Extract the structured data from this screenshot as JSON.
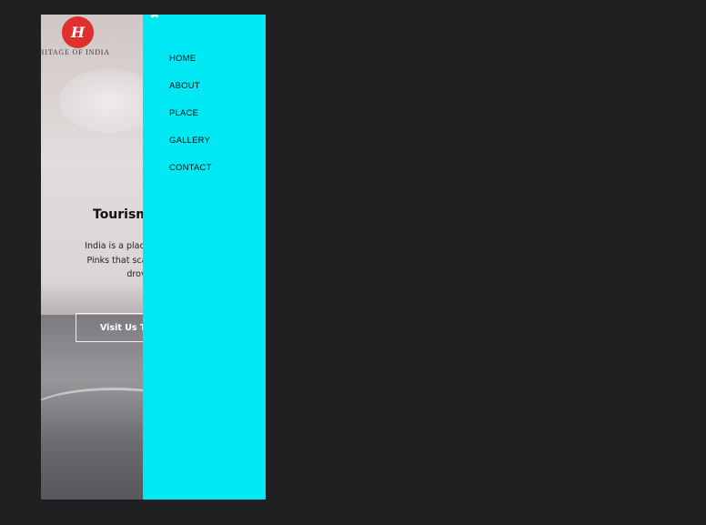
{
  "brand": {
    "logo_letter": "H",
    "name": "HERITAGE OF INDIA",
    "logo_color": "#e0302e"
  },
  "hero": {
    "title": "Tourism",
    "text_lines": [
      "India is a place where",
      "Pinks that scald your",
      "drov"
    ],
    "cta_label": "Visit Us To"
  },
  "drawer": {
    "background": "#00e8f3",
    "close_icon": "close-icon",
    "menu": [
      {
        "label": "HOME"
      },
      {
        "label": "ABOUT"
      },
      {
        "label": "PLACE"
      },
      {
        "label": "GALLERY"
      },
      {
        "label": "CONTACT"
      }
    ]
  }
}
